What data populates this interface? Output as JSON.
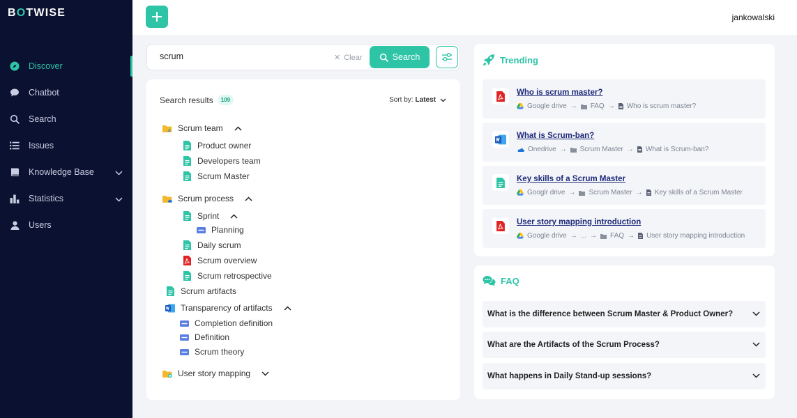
{
  "brand": {
    "logo_pre": "B",
    "logo_o": "O",
    "logo_post": "TWISE",
    "accent": "#2ec4a6",
    "sidebar_bg": "#0b1130"
  },
  "user": {
    "name": "jankowalski"
  },
  "sidebar": {
    "items": [
      {
        "label": "Discover",
        "icon": "compass-icon",
        "active": true
      },
      {
        "label": "Chatbot",
        "icon": "chat-bubble-icon"
      },
      {
        "label": "Search",
        "icon": "search-icon"
      },
      {
        "label": "Issues",
        "icon": "list-icon"
      },
      {
        "label": "Knowledge Base",
        "icon": "book-icon",
        "expandable": true
      },
      {
        "label": "Statistics",
        "icon": "bar-chart-icon",
        "expandable": true
      },
      {
        "label": "Users",
        "icon": "user-icon"
      }
    ]
  },
  "search": {
    "value": "scrum",
    "placeholder": "",
    "clear_label": "Clear",
    "button_label": "Search"
  },
  "results": {
    "title": "Search results",
    "count": "109",
    "sort_label": "Sort by:",
    "sort_value": "Latest",
    "tree": [
      {
        "label": "Scrum team",
        "icon": "folder-drive-icon",
        "expanded": true
      },
      {
        "label": "Product owner",
        "icon": "doc-icon"
      },
      {
        "label": "Developers team",
        "icon": "doc-icon"
      },
      {
        "label": "Scrum Master",
        "icon": "doc-icon"
      },
      {
        "label": "Scrum process",
        "icon": "folder-cloud-icon",
        "expanded": true
      },
      {
        "label": "Sprint",
        "icon": "doc-icon",
        "expanded": true
      },
      {
        "label": "Planning",
        "icon": "text-block-icon"
      },
      {
        "label": "Daily scrum",
        "icon": "doc-icon"
      },
      {
        "label": "Scrum overview",
        "icon": "pdf-icon"
      },
      {
        "label": "Scrum retrospective",
        "icon": "doc-icon"
      },
      {
        "label": "Scrum artifacts",
        "icon": "doc-icon"
      },
      {
        "label": "Transparency of artifacts",
        "icon": "word-icon",
        "expanded": true
      },
      {
        "label": "Completion definition",
        "icon": "text-block-icon"
      },
      {
        "label": "Definition",
        "icon": "text-block-icon"
      },
      {
        "label": "Scrum theory",
        "icon": "text-block-icon"
      },
      {
        "label": "User story mapping",
        "icon": "folder-green-icon",
        "expanded": false
      }
    ]
  },
  "trending": {
    "title": "Trending",
    "items": [
      {
        "title": "Who is scrum master?",
        "icon": "pdf-icon",
        "source_icon": "google-drive-icon",
        "path": [
          "Google drive",
          "FAQ",
          "Who is scrum master?"
        ]
      },
      {
        "title": "What is Scrum-ban?",
        "icon": "word-icon",
        "source_icon": "onedrive-icon",
        "path": [
          "Onedrive",
          "Scrum Master",
          "What is Scrum-ban?"
        ]
      },
      {
        "title": "Key skills of a Scrum Master",
        "icon": "doc-icon",
        "source_icon": "google-drive-icon",
        "path": [
          "Googlr drive",
          "Scrum Master",
          "Key skills of a Scrum Master"
        ]
      },
      {
        "title": "User story mapping introduction",
        "icon": "pdf-icon",
        "source_icon": "google-drive-icon",
        "path": [
          "Google drive",
          "...",
          "FAQ",
          "User story mapping introduction"
        ]
      }
    ]
  },
  "faq": {
    "title": "FAQ",
    "items": [
      {
        "question": "What is the difference between Scrum Master & Product Owner?"
      },
      {
        "question": "What are the Artifacts of the Scrum Process?"
      },
      {
        "question": "What happens in Daily Stand-up sessions?"
      }
    ]
  }
}
